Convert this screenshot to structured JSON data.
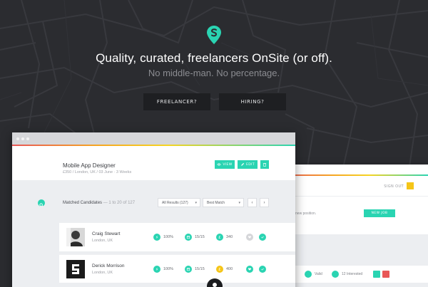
{
  "hero": {
    "title": "Quality, curated, freelancers OnSite (or off).",
    "subtitle": "No middle-man. No percentage.",
    "freelancer_button": "FREELANCER?",
    "hiring_button": "HIRING?",
    "logo_icon": "location-pin-s-icon"
  },
  "colors": {
    "accent": "#2ad4b2",
    "background": "#2b2c30",
    "button_dark": "#1e1f22",
    "gold": "#f5c518",
    "danger": "#e85757"
  },
  "job": {
    "title": "Mobile App Designer",
    "meta": "£350 / London, UK / 03 June · 3 Weeks",
    "view_label": "VIEW",
    "edit_label": "EDIT"
  },
  "candidates_header": {
    "label": "Matched Candidates",
    "range": "— 1 to 20 of 127",
    "filter_value": "All Results (127)",
    "sort_value": "Best Match"
  },
  "candidates": [
    {
      "name": "Craig Stewart",
      "location": "London, UK",
      "match": "100%",
      "days": "15/15",
      "stat": "340"
    },
    {
      "name": "Derick Morrison",
      "location": "London, UK",
      "match": "100%",
      "days": "15/15",
      "stat": "400"
    }
  ],
  "back_window": {
    "signout": "SIGN OUT",
    "text": "post a new position.",
    "new_job": "NEW JOB",
    "valid": "Valid",
    "interested": "12 Interested"
  }
}
